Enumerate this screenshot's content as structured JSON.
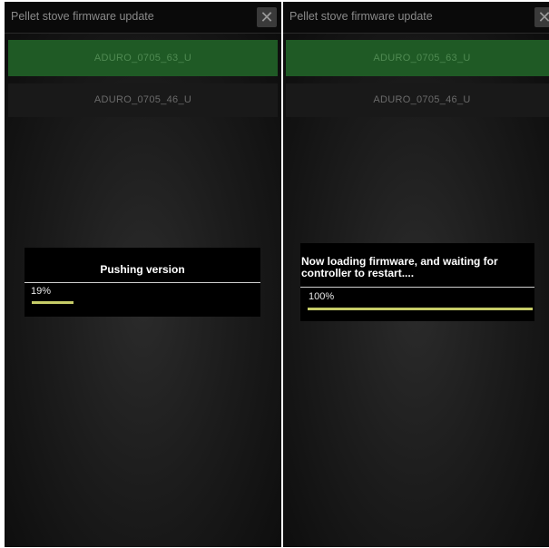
{
  "screens": [
    {
      "header": {
        "title": "Pellet stove firmware update",
        "close_glyph": "✕"
      },
      "devices": [
        {
          "label": "ADURO_0705_63_U",
          "selected": true
        },
        {
          "label": "ADURO_0705_46_U",
          "selected": false
        }
      ],
      "dialog": {
        "title": "Pushing version",
        "progress_text": "19%",
        "progress": 0.19
      }
    },
    {
      "header": {
        "title": "Pellet stove firmware update",
        "close_glyph": "✕"
      },
      "devices": [
        {
          "label": "ADURO_0705_63_U",
          "selected": true
        },
        {
          "label": "ADURO_0705_46_U",
          "selected": false
        }
      ],
      "dialog": {
        "title": "Now loading firmware, and waiting for controller to restart....",
        "progress_text": "100%",
        "progress": 1.0
      }
    }
  ],
  "colors": {
    "selected_device": "#1f5a25",
    "progress_fill": "#c6cc68",
    "background": "#1c1c1c"
  }
}
